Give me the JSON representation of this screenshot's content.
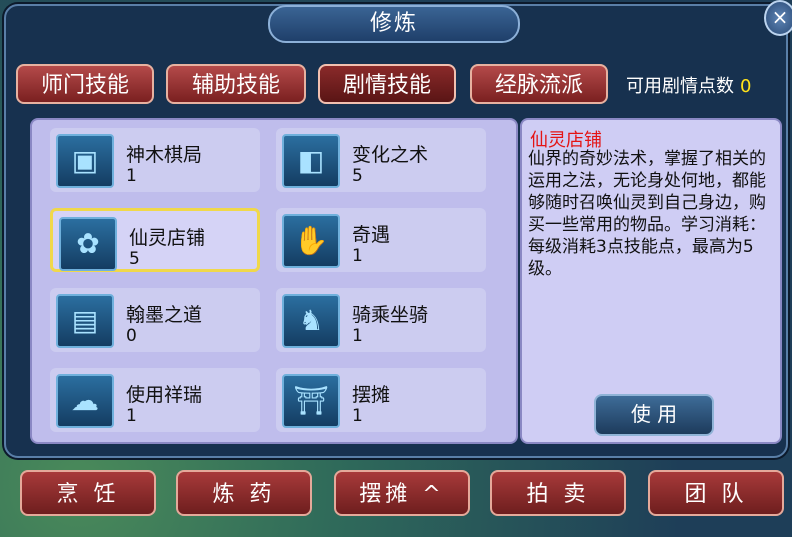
{
  "window": {
    "title": "修炼",
    "close_glyph": "×"
  },
  "tabs": [
    {
      "label": "师门技能"
    },
    {
      "label": "辅助技能"
    },
    {
      "label": "剧情技能"
    },
    {
      "label": "经脉流派"
    }
  ],
  "points": {
    "label": "可用剧情点数",
    "value": "0"
  },
  "skills": [
    {
      "name": "神木棋局",
      "level": "1",
      "icon": "board-icon"
    },
    {
      "name": "变化之术",
      "level": "5",
      "icon": "transform-icon"
    },
    {
      "name": "仙灵店铺",
      "level": "5",
      "icon": "shop-icon"
    },
    {
      "name": "奇遇",
      "level": "1",
      "icon": "hand-star-icon"
    },
    {
      "name": "翰墨之道",
      "level": "0",
      "icon": "book-icon"
    },
    {
      "name": "骑乘坐骑",
      "level": "1",
      "icon": "rider-icon"
    },
    {
      "name": "使用祥瑞",
      "level": "1",
      "icon": "cloud-icon"
    },
    {
      "name": "摆摊",
      "level": "1",
      "icon": "stall-icon"
    }
  ],
  "detail": {
    "title": "仙灵店铺",
    "body": "仙界的奇妙法术，掌握了相关的运用之法，无论身处何地，都能够随时召唤仙灵到自己身边，购买一些常用的物品。学习消耗：每级消耗3点技能点，最高为5级。",
    "use_label": "使 用"
  },
  "bottom": [
    {
      "label": "烹 饪"
    },
    {
      "label": "炼 药"
    },
    {
      "label": "摆摊 ^"
    },
    {
      "label": "拍 卖"
    },
    {
      "label": "团 队"
    }
  ]
}
